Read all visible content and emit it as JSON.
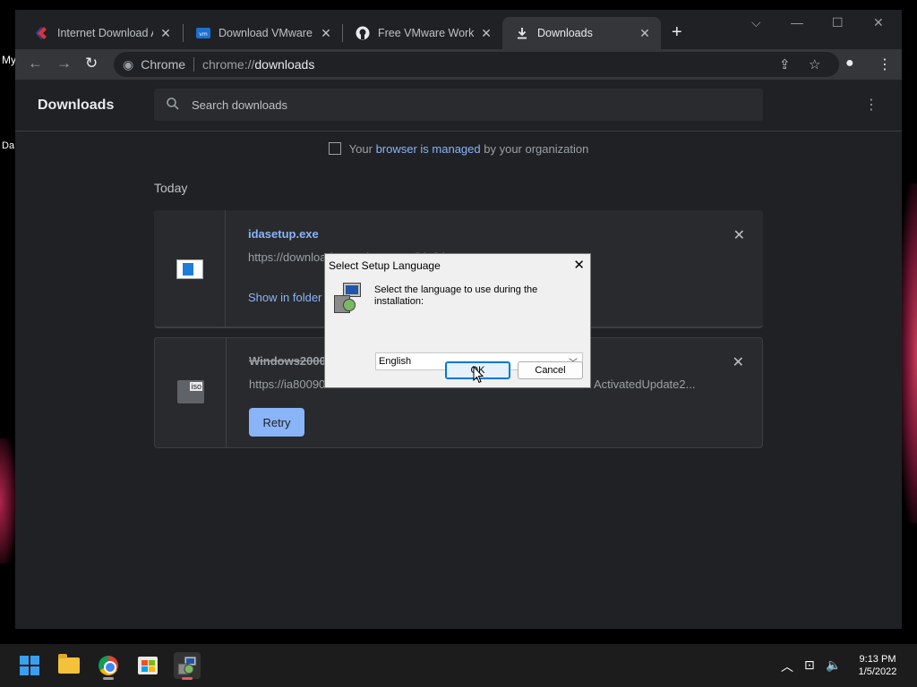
{
  "desktop": {
    "labels": [
      "My",
      "Da"
    ]
  },
  "browser": {
    "tabs": [
      {
        "title": "Internet Download Accelerator",
        "favicon": "ida-icon",
        "active": false
      },
      {
        "title": "Download VMware Workstation",
        "favicon": "vmware-icon",
        "active": false
      },
      {
        "title": "Free VMware Workstation",
        "favicon": "github-icon",
        "active": false
      },
      {
        "title": "Downloads",
        "favicon": "download-icon",
        "active": true
      }
    ],
    "new_tab": "+",
    "omnibox": {
      "chip": "Chrome",
      "url_prefix": "chrome://",
      "url_main": "downloads"
    }
  },
  "downloads": {
    "title": "Downloads",
    "search_placeholder": "Search downloads",
    "managed_prefix": "Your",
    "managed_link": "browser is managed",
    "managed_suffix": "by your organization",
    "day_label": "Today",
    "items": [
      {
        "filename": "idasetup.exe",
        "url": "https://download1.westbyte.com/ida/idasetup.exe",
        "action": "Show in folder",
        "status": "complete"
      },
      {
        "filename": "Windows2000",
        "url_start": "https://ia80090",
        "url_end": "ActivatedUpdate2...",
        "action": "Retry",
        "status": "failed"
      }
    ]
  },
  "dialog": {
    "title": "Select Setup Language",
    "message": "Select the language to use during the installation:",
    "selected_language": "English",
    "ok_label": "OK",
    "cancel_label": "Cancel"
  },
  "taskbar": {
    "time": "9:13 PM",
    "date": "1/5/2022"
  },
  "colors": {
    "accent": "#8ab4f8",
    "page_bg": "#202124",
    "taskbar_bg": "#1c1c1c"
  }
}
